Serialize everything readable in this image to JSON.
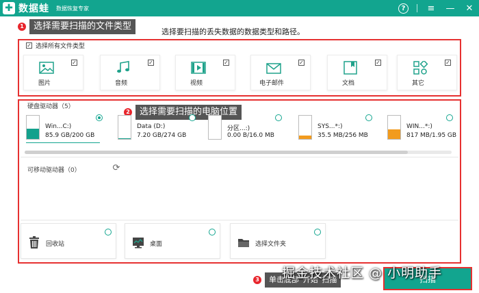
{
  "app": {
    "logo_mark": "✚",
    "name": "数据蛙",
    "subtitle": "数据恢复专家",
    "help_icon": "?",
    "menu_icon": "≡",
    "minimize_icon": "—",
    "close_icon": "✕",
    "brand_color": "#12a58f"
  },
  "steps": {
    "step1": {
      "num": "1",
      "label": "选择需要扫描的文件类型"
    },
    "step2": {
      "num": "2",
      "label": "选择需要扫描的电脑位置"
    },
    "step3": {
      "num": "3",
      "label": "单击底部“开始”扫描"
    }
  },
  "instruction": "选择要扫描的丢失数据的数据类型和路径。",
  "file_types": {
    "select_all_label": "选择所有文件类型",
    "select_all_checked": "✓",
    "items": [
      {
        "label": "图片",
        "icon": "image-icon",
        "checked": "✓"
      },
      {
        "label": "音频",
        "icon": "music-icon",
        "checked": "✓"
      },
      {
        "label": "视频",
        "icon": "video-icon",
        "checked": "✓"
      },
      {
        "label": "电子邮件",
        "icon": "email-icon",
        "checked": "✓"
      },
      {
        "label": "文档",
        "icon": "document-icon",
        "checked": "✓"
      },
      {
        "label": "其它",
        "icon": "other-icon",
        "checked": "✓"
      }
    ]
  },
  "hard_drives": {
    "title": "硬盘驱动器（5）",
    "items": [
      {
        "name": "Win...C:)",
        "size": "85.9 GB/200 GB",
        "selected": true,
        "fill_color": "#13a18c",
        "used_fraction": 0.43
      },
      {
        "name": "Data (D:)",
        "size": "7.20 GB/274 GB",
        "selected": false,
        "fill_color": "#13a18c",
        "used_fraction": 0.03
      },
      {
        "name": "分区...:)",
        "size": "0.00  B/16.0 MB",
        "selected": false,
        "fill_color": "#13a18c",
        "used_fraction": 0.0
      },
      {
        "name": "SYS...*:)",
        "size": "35.5 MB/256 MB",
        "selected": false,
        "fill_color": "#f29b1e",
        "used_fraction": 0.14
      },
      {
        "name": "WIN...*:)",
        "size": "817 MB/1.95 GB",
        "selected": false,
        "fill_color": "#f29b1e",
        "used_fraction": 0.42
      }
    ]
  },
  "removable_drives": {
    "title": "可移动驱动器（0）",
    "refresh_icon": "⟳"
  },
  "locations": [
    {
      "label": "回收站",
      "icon": "recycle-bin-icon"
    },
    {
      "label": "桌面",
      "icon": "desktop-icon"
    },
    {
      "label": "选择文件夹",
      "icon": "folder-icon"
    }
  ],
  "scan_button": "扫描",
  "watermark": "掘金技术社区 @ 小明助手"
}
